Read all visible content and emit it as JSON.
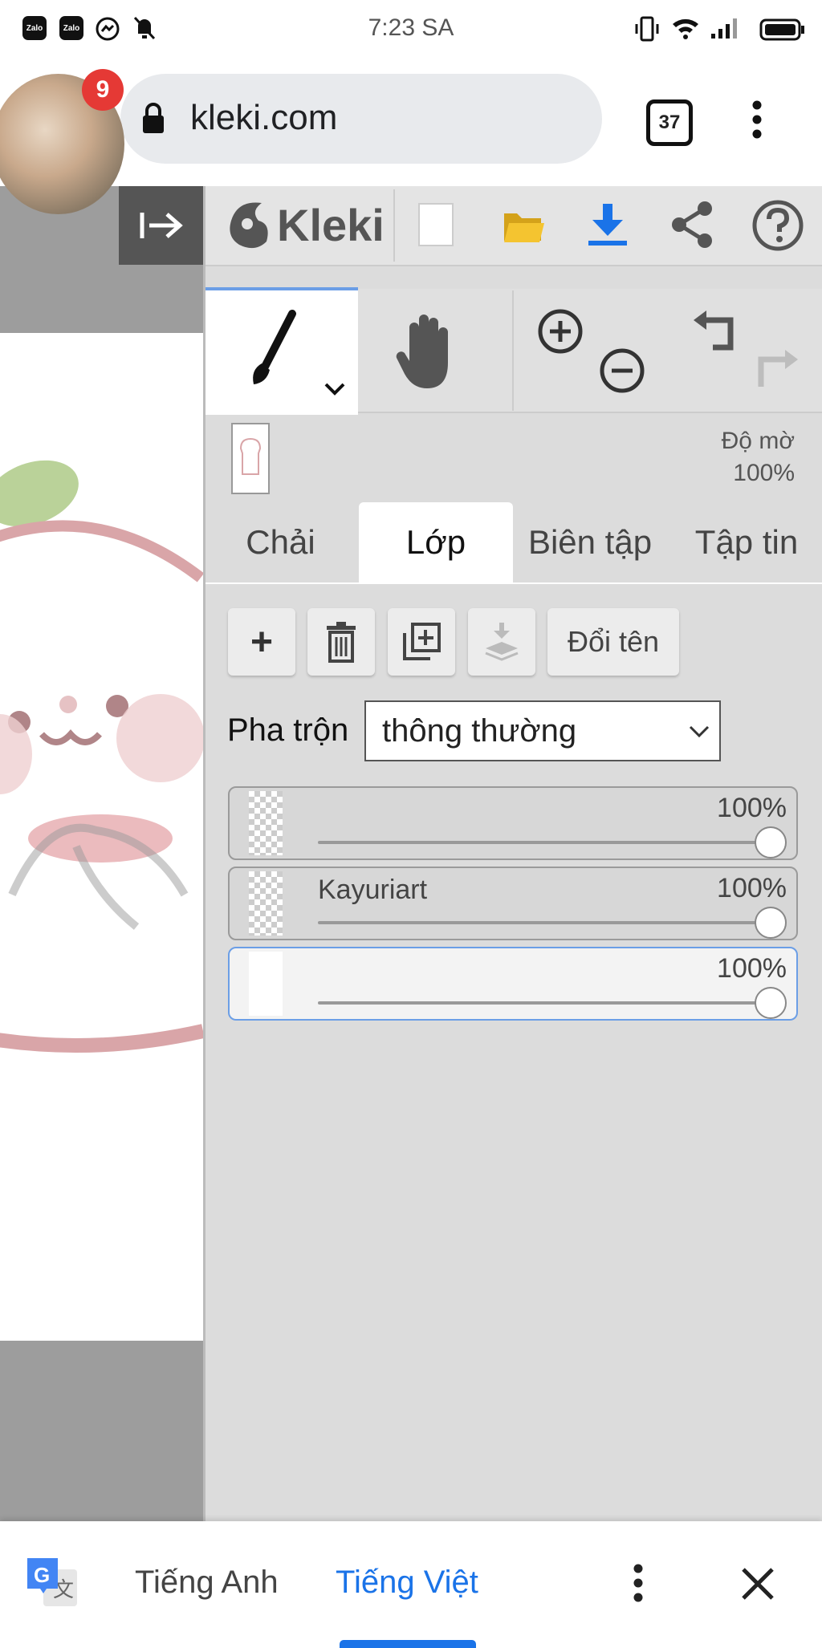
{
  "status_bar": {
    "time": "7:23 SA",
    "left_icons": [
      "zalo-icon",
      "zalo-icon",
      "messenger-icon",
      "bell-off-icon"
    ],
    "right_icons": [
      "vibrate-icon",
      "wifi-icon",
      "signal-icon",
      "battery-icon"
    ]
  },
  "browser": {
    "url": "kleki.com",
    "tab_count": "37",
    "notification_badge": "9"
  },
  "app": {
    "logo_text": "Kleki",
    "toolbar_icons": [
      "new-file-icon",
      "open-folder-icon",
      "download-icon",
      "share-icon",
      "help-icon"
    ],
    "tools": [
      "brush-icon",
      "hand-icon",
      "zoom-in-icon",
      "zoom-out-icon",
      "undo-icon",
      "redo-icon"
    ],
    "opacity_label": "Độ mờ",
    "opacity_value": "100%",
    "tabs": [
      {
        "label": "Chải",
        "active": false
      },
      {
        "label": "Lớp",
        "active": true
      },
      {
        "label": "Biên tập",
        "active": false
      },
      {
        "label": "Tập tin",
        "active": false
      }
    ],
    "layer_buttons": {
      "add": "+",
      "rename": "Đổi tên"
    },
    "blend": {
      "label": "Pha trộn",
      "value": "thông thường"
    },
    "layers": [
      {
        "name": "",
        "opacity": "100%",
        "fill": 1.0,
        "active": false
      },
      {
        "name": "Kayuriart",
        "opacity": "100%",
        "fill": 1.0,
        "active": false
      },
      {
        "name": "",
        "opacity": "100%",
        "fill": 1.0,
        "active": true
      }
    ]
  },
  "translate_bar": {
    "lang_from": "Tiếng Anh",
    "lang_to": "Tiếng Việt",
    "accent": "#1a73e8"
  }
}
